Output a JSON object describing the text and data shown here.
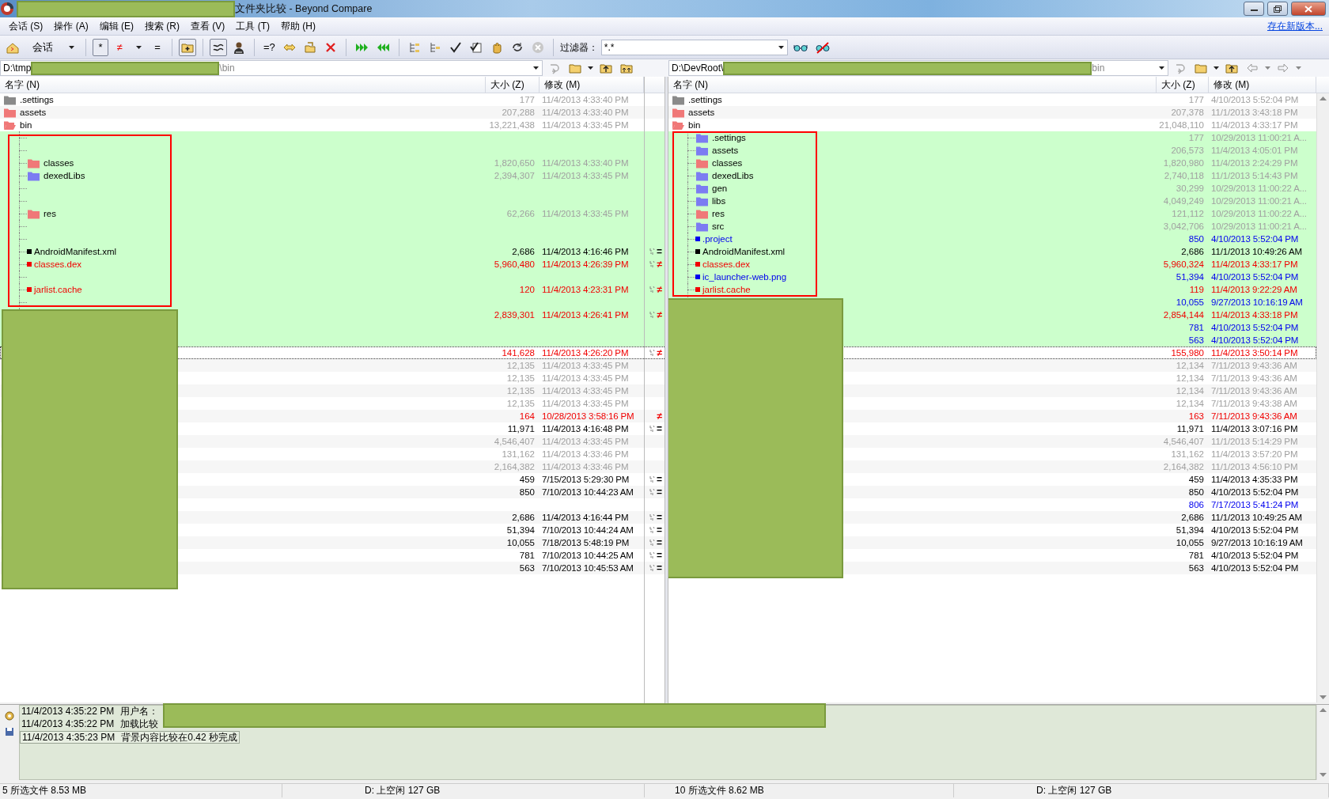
{
  "window": {
    "title": "文件夹比较 - Beyond Compare"
  },
  "menu": [
    "会话 (S)",
    "操作 (A)",
    "编辑 (E)",
    "搜索 (R)",
    "查看 (V)",
    "工具 (T)",
    "帮助 (H)"
  ],
  "update_link": "存在新版本...",
  "toolbar": {
    "session": "会话",
    "view_filters": [
      {
        "label": "*",
        "pressed": true
      },
      {
        "label": "≠",
        "pressed": false
      },
      {
        "label": "=",
        "pressed": false
      }
    ],
    "compare_contents": "=?",
    "filter_label": "过滤器：",
    "filter_value": "*.*"
  },
  "left_path": {
    "prefix": "D:\\tmp",
    "suffix": "\\bin"
  },
  "right_path": {
    "prefix": "D:\\DevRoot\\",
    "suffix": "bin"
  },
  "left_columns": [
    "名字 (N)",
    "大小 (Z)",
    "修改 (M)"
  ],
  "right_columns": [
    "名字 (N)",
    "大小 (Z)",
    "修改 (M)"
  ],
  "rows": [
    {
      "selected": false,
      "focused": false,
      "left": {
        "kind": "folder",
        "name": ".settings",
        "color": "#8a8a8a",
        "size": "177",
        "modified": "11/4/2013 4:33:40 PM"
      },
      "right": {
        "kind": "folder",
        "name": ".settings",
        "color": "#8a8a8a",
        "size": "177",
        "modified": "4/10/2013 5:52:04 PM"
      }
    },
    {
      "selected": false,
      "focused": false,
      "left": {
        "kind": "folder",
        "name": "assets",
        "color": "#f07878",
        "size": "207,288",
        "modified": "11/4/2013 4:33:40 PM"
      },
      "right": {
        "kind": "folder",
        "name": "assets",
        "color": "#f07878",
        "size": "207,378",
        "modified": "11/1/2013 3:43:18 PM"
      }
    },
    {
      "selected": false,
      "focused": false,
      "expanded": true,
      "left": {
        "kind": "folder",
        "name": "bin",
        "color": "#f07878",
        "size": "13,221,438",
        "modified": "11/4/2013 4:33:45 PM"
      },
      "right": {
        "kind": "folder",
        "name": "bin",
        "color": "#f07878",
        "size": "21,048,110",
        "modified": "11/4/2013 4:33:17 PM"
      },
      "children": [
        {
          "selected": true,
          "focused": false,
          "left": {
            "kind": "empty"
          },
          "right": {
            "kind": "folder",
            "name": ".settings",
            "color": "#7c7cf2",
            "size": "177",
            "modified": "10/29/2013 11:00:21 A..."
          }
        },
        {
          "selected": true,
          "focused": false,
          "left": {
            "kind": "empty"
          },
          "right": {
            "kind": "folder",
            "name": "assets",
            "color": "#7c7cf2",
            "size": "206,573",
            "modified": "11/4/2013 4:05:01 PM"
          }
        },
        {
          "selected": true,
          "focused": false,
          "left": {
            "kind": "folder",
            "name": "classes",
            "color": "#f07878",
            "size": "1,820,650",
            "modified": "11/4/2013 4:33:40 PM"
          },
          "right": {
            "kind": "folder",
            "name": "classes",
            "color": "#f07878",
            "size": "1,820,980",
            "modified": "11/4/2013 2:24:29 PM"
          }
        },
        {
          "selected": true,
          "focused": false,
          "left": {
            "kind": "folder",
            "name": "dexedLibs",
            "color": "#7c7cf2",
            "size": "2,394,307",
            "modified": "11/4/2013 4:33:45 PM"
          },
          "right": {
            "kind": "folder",
            "name": "dexedLibs",
            "color": "#7c7cf2",
            "size": "2,740,118",
            "modified": "11/1/2013 5:14:43 PM"
          }
        },
        {
          "selected": true,
          "focused": false,
          "left": {
            "kind": "empty"
          },
          "right": {
            "kind": "folder",
            "name": "gen",
            "color": "#7c7cf2",
            "size": "30,299",
            "modified": "10/29/2013 11:00:22 A..."
          }
        },
        {
          "selected": true,
          "focused": false,
          "left": {
            "kind": "empty"
          },
          "right": {
            "kind": "folder",
            "name": "libs",
            "color": "#7c7cf2",
            "size": "4,049,249",
            "modified": "10/29/2013 11:00:21 A..."
          }
        },
        {
          "selected": true,
          "focused": false,
          "left": {
            "kind": "folder",
            "name": "res",
            "color": "#f07878",
            "size": "62,266",
            "modified": "11/4/2013 4:33:45 PM"
          },
          "right": {
            "kind": "folder",
            "name": "res",
            "color": "#f07878",
            "size": "121,112",
            "modified": "10/29/2013 11:00:22 A..."
          }
        },
        {
          "selected": true,
          "focused": false,
          "left": {
            "kind": "empty"
          },
          "right": {
            "kind": "folder",
            "name": "src",
            "color": "#7c7cf2",
            "size": "3,042,706",
            "modified": "10/29/2013 11:00:21 A..."
          }
        },
        {
          "selected": true,
          "focused": false,
          "left": {
            "kind": "empty"
          },
          "right": {
            "kind": "file",
            "name": ".project",
            "orphan": true,
            "size": "850",
            "modified": "4/10/2013 5:52:04 PM"
          }
        },
        {
          "selected": true,
          "focused": false,
          "left": {
            "kind": "file",
            "name": "AndroidManifest.xml",
            "differs": false,
            "orphan": false,
            "size": "2,686",
            "modified": "11/4/2013 4:16:46 PM"
          },
          "compare": {
            "mark": "=",
            "differs": false,
            "time_icon": true
          },
          "right": {
            "kind": "file",
            "name": "AndroidManifest.xml",
            "differs": false,
            "orphan": false,
            "size": "2,686",
            "modified": "11/1/2013 10:49:26 AM"
          }
        },
        {
          "selected": true,
          "focused": false,
          "left": {
            "kind": "file",
            "name": "classes.dex",
            "differs": true,
            "orphan": false,
            "size": "5,960,480",
            "modified": "11/4/2013 4:26:39 PM"
          },
          "compare": {
            "mark": "≠",
            "differs": true,
            "time_icon": true
          },
          "right": {
            "kind": "file",
            "name": "classes.dex",
            "differs": true,
            "orphan": false,
            "size": "5,960,324",
            "modified": "11/4/2013 4:33:17 PM"
          }
        },
        {
          "selected": true,
          "focused": false,
          "left": {
            "kind": "empty"
          },
          "right": {
            "kind": "file",
            "name": "ic_launcher-web.png",
            "orphan": true,
            "size": "51,394",
            "modified": "4/10/2013 5:52:04 PM"
          }
        },
        {
          "selected": true,
          "focused": false,
          "left": {
            "kind": "file",
            "name": "jarlist.cache",
            "differs": true,
            "orphan": false,
            "size": "120",
            "modified": "11/4/2013 4:23:31 PM"
          },
          "compare": {
            "mark": "≠",
            "differs": true,
            "time_icon": true
          },
          "right": {
            "kind": "file",
            "name": "jarlist.cache",
            "differs": true,
            "orphan": false,
            "size": "119",
            "modified": "11/4/2013 9:22:29 AM"
          }
        },
        {
          "selected": true,
          "focused": false,
          "left": {
            "kind": "empty"
          },
          "right": {
            "kind": "file",
            "orphan": true,
            "size": "10,055",
            "modified": "9/27/2013 10:16:19 AM"
          }
        },
        {
          "selected": true,
          "focused": false,
          "left": {
            "kind": "file",
            "differs": true,
            "orphan": false,
            "size": "2,839,301",
            "modified": "11/4/2013 4:26:41 PM"
          },
          "compare": {
            "mark": "≠",
            "differs": true,
            "time_icon": true
          },
          "right": {
            "kind": "file",
            "differs": true,
            "orphan": false,
            "size": "2,854,144",
            "modified": "11/4/2013 4:33:18 PM"
          }
        },
        {
          "selected": true,
          "focused": false,
          "left": {
            "kind": "empty"
          },
          "right": {
            "kind": "file",
            "orphan": true,
            "size": "781",
            "modified": "4/10/2013 5:52:04 PM"
          }
        },
        {
          "selected": true,
          "focused": false,
          "left": {
            "kind": "empty"
          },
          "right": {
            "kind": "file",
            "orphan": true,
            "size": "563",
            "modified": "4/10/2013 5:52:04 PM"
          }
        },
        {
          "selected": false,
          "focused": true,
          "left": {
            "kind": "file",
            "differs": true,
            "orphan": false,
            "size": "141,628",
            "modified": "11/4/2013 4:26:20 PM"
          },
          "compare": {
            "mark": "≠",
            "differs": true,
            "time_icon": true
          },
          "right": {
            "kind": "file",
            "differs": true,
            "orphan": false,
            "size": "155,980",
            "modified": "11/4/2013 3:50:14 PM"
          }
        },
        {
          "selected": false,
          "focused": false,
          "left": {
            "kind": "folder",
            "size": "12,135",
            "modified": "11/4/2013 4:33:45 PM"
          },
          "right": {
            "kind": "folder",
            "size": "12,134",
            "modified": "7/11/2013 9:43:36 AM"
          }
        },
        {
          "selected": false,
          "focused": false,
          "left": {
            "kind": "folder",
            "size": "12,135",
            "modified": "11/4/2013 4:33:45 PM"
          },
          "right": {
            "kind": "folder",
            "size": "12,134",
            "modified": "7/11/2013 9:43:36 AM"
          }
        },
        {
          "selected": false,
          "focused": false,
          "left": {
            "kind": "folder",
            "size": "12,135",
            "modified": "11/4/2013 4:33:45 PM"
          },
          "right": {
            "kind": "folder",
            "size": "12,134",
            "modified": "7/11/2013 9:43:36 AM"
          }
        },
        {
          "selected": false,
          "focused": false,
          "left": {
            "kind": "folder",
            "size": "12,135",
            "modified": "11/4/2013 4:33:45 PM"
          },
          "right": {
            "kind": "folder",
            "size": "12,134",
            "modified": "7/11/2013 9:43:38 AM"
          }
        },
        {
          "selected": false,
          "focused": false,
          "left": {
            "kind": "file",
            "differs": true,
            "orphan": false,
            "size": "164",
            "modified": "10/28/2013 3:58:16 PM"
          },
          "compare": {
            "mark": "≠",
            "differs": true,
            "time_icon": false
          },
          "right": {
            "kind": "file",
            "differs": true,
            "orphan": false,
            "size": "163",
            "modified": "7/11/2013 9:43:36 AM"
          }
        },
        {
          "selected": false,
          "focused": false,
          "left": {
            "kind": "file",
            "differs": false,
            "orphan": false,
            "size": "11,971",
            "modified": "11/4/2013 4:16:48 PM"
          },
          "compare": {
            "mark": "=",
            "differs": false,
            "time_icon": true
          },
          "right": {
            "kind": "file",
            "differs": false,
            "orphan": false,
            "size": "11,971",
            "modified": "11/4/2013 3:07:16 PM"
          }
        },
        {
          "selected": false,
          "focused": false,
          "left": {
            "kind": "folder",
            "size": "4,546,407",
            "modified": "11/4/2013 4:33:45 PM"
          },
          "right": {
            "kind": "folder",
            "size": "4,546,407",
            "modified": "11/1/2013 5:14:29 PM"
          }
        },
        {
          "selected": false,
          "focused": false,
          "left": {
            "kind": "folder",
            "size": "131,162",
            "modified": "11/4/2013 4:33:46 PM"
          },
          "right": {
            "kind": "folder",
            "size": "131,162",
            "modified": "11/4/2013 3:57:20 PM"
          }
        },
        {
          "selected": false,
          "focused": false,
          "left": {
            "kind": "folder",
            "size": "2,164,382",
            "modified": "11/4/2013 4:33:46 PM"
          },
          "right": {
            "kind": "folder",
            "size": "2,164,382",
            "modified": "11/1/2013 4:56:10 PM"
          }
        },
        {
          "selected": false,
          "focused": false,
          "left": {
            "kind": "file",
            "differs": false,
            "orphan": false,
            "size": "459",
            "modified": "7/15/2013 5:29:30 PM"
          },
          "compare": {
            "mark": "=",
            "differs": false,
            "time_icon": true
          },
          "right": {
            "kind": "file",
            "differs": false,
            "orphan": false,
            "size": "459",
            "modified": "11/4/2013 4:35:33 PM"
          }
        },
        {
          "selected": false,
          "focused": false,
          "left": {
            "kind": "file",
            "differs": false,
            "orphan": false,
            "size": "850",
            "modified": "7/10/2013 10:44:23 AM"
          },
          "compare": {
            "mark": "=",
            "differs": false,
            "time_icon": true
          },
          "right": {
            "kind": "file",
            "differs": false,
            "orphan": false,
            "size": "850",
            "modified": "4/10/2013 5:52:04 PM"
          }
        },
        {
          "selected": false,
          "focused": false,
          "left": {
            "kind": "empty"
          },
          "right": {
            "kind": "file",
            "orphan": true,
            "size": "806",
            "modified": "7/17/2013 5:41:24 PM"
          }
        },
        {
          "selected": false,
          "focused": false,
          "left": {
            "kind": "file",
            "differs": false,
            "orphan": false,
            "size": "2,686",
            "modified": "11/4/2013 4:16:44 PM"
          },
          "compare": {
            "mark": "=",
            "differs": false,
            "time_icon": true
          },
          "right": {
            "kind": "file",
            "differs": false,
            "orphan": false,
            "size": "2,686",
            "modified": "11/1/2013 10:49:25 AM"
          }
        },
        {
          "selected": false,
          "focused": false,
          "left": {
            "kind": "file",
            "differs": false,
            "orphan": false,
            "size": "51,394",
            "modified": "7/10/2013 10:44:24 AM"
          },
          "compare": {
            "mark": "=",
            "differs": false,
            "time_icon": true
          },
          "right": {
            "kind": "file",
            "differs": false,
            "orphan": false,
            "size": "51,394",
            "modified": "4/10/2013 5:52:04 PM"
          }
        },
        {
          "selected": false,
          "focused": false,
          "left": {
            "kind": "file",
            "differs": false,
            "orphan": false,
            "size": "10,055",
            "modified": "7/18/2013 5:48:19 PM"
          },
          "compare": {
            "mark": "=",
            "differs": false,
            "time_icon": true
          },
          "right": {
            "kind": "file",
            "differs": false,
            "orphan": false,
            "size": "10,055",
            "modified": "9/27/2013 10:16:19 AM"
          }
        },
        {
          "selected": false,
          "focused": false,
          "left": {
            "kind": "file",
            "differs": false,
            "orphan": false,
            "size": "781",
            "modified": "7/10/2013 10:44:25 AM"
          },
          "compare": {
            "mark": "=",
            "differs": false,
            "time_icon": true
          },
          "right": {
            "kind": "file",
            "differs": false,
            "orphan": false,
            "size": "781",
            "modified": "4/10/2013 5:52:04 PM"
          }
        },
        {
          "selected": false,
          "focused": false,
          "left": {
            "kind": "file",
            "differs": false,
            "orphan": false,
            "size": "563",
            "modified": "7/10/2013 10:45:53 AM"
          },
          "compare": {
            "mark": "=",
            "differs": false,
            "time_icon": true
          },
          "right": {
            "kind": "file",
            "differs": false,
            "orphan": false,
            "size": "563",
            "modified": "4/10/2013 5:52:04 PM"
          }
        }
      ]
    }
  ],
  "log": [
    {
      "time": "11/4/2013 4:35:22 PM",
      "message": "用户名：",
      "selected": false
    },
    {
      "time": "11/4/2013 4:35:22 PM",
      "message": "加载比较",
      "selected": false
    },
    {
      "time": "11/4/2013 4:35:23 PM",
      "message": "背景内容比较在0.42 秒完成",
      "selected": true
    }
  ],
  "status_bar": [
    "5 所选文件 8.53 MB",
    "D: 上空闲 127 GB",
    "10 所选文件 8.62 MB",
    "D: 上空闲 127 GB"
  ]
}
